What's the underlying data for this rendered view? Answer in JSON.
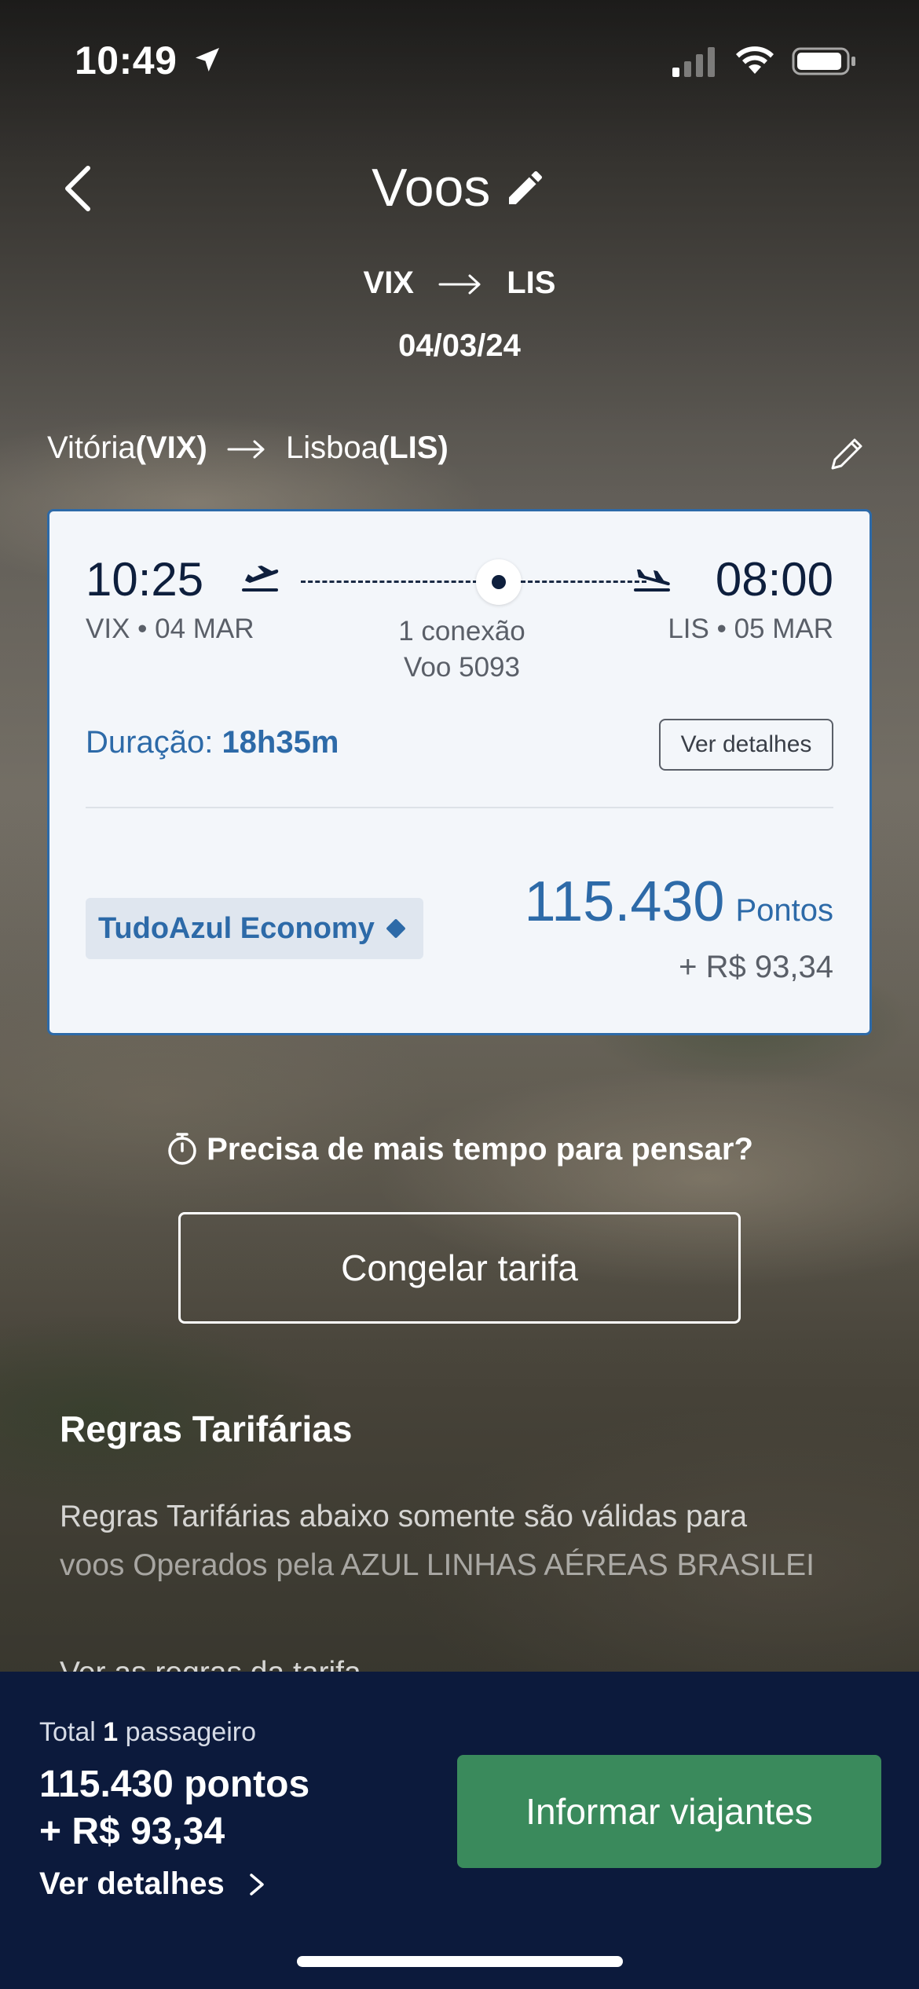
{
  "status_bar": {
    "time": "10:49"
  },
  "header": {
    "title": "Voos",
    "origin_code": "VIX",
    "destination_code": "LIS",
    "date": "04/03/24"
  },
  "leg": {
    "origin_city": "Vitória",
    "origin_code": "(VIX)",
    "destination_city": "Lisboa",
    "destination_code": "(LIS)"
  },
  "flight_card": {
    "departure_time": "10:25",
    "departure_info": "VIX • 04 MAR",
    "arrival_time": "08:00",
    "arrival_info": "LIS • 05 MAR",
    "connections": "1 conexão",
    "flight_number": "Voo 5093",
    "duration_label": "Duração:",
    "duration_value": "18h35m",
    "details_button": "Ver detalhes",
    "fare_name": "TudoAzul Economy",
    "points": "115.430",
    "points_unit": "Pontos",
    "money": "+ R$ 93,34",
    "accent_color": "#2d6aa8"
  },
  "freeze": {
    "question": "Precisa de mais tempo para pensar?",
    "button": "Congelar tarifa"
  },
  "rules": {
    "title": "Regras Tarifárias",
    "line1": "Regras Tarifárias abaixo somente são válidas para",
    "line2": "voos Operados pela AZUL LINHAS AÉREAS BRASILEI",
    "link": "Ver as regras da tarifa"
  },
  "bottom_bar": {
    "total_prefix": "Total",
    "passenger_count": "1",
    "passenger_label": "passageiro",
    "points_total": "115.430 pontos",
    "money_total": "+ R$ 93,34",
    "details_link": "Ver detalhes",
    "cta": "Informar viajantes",
    "cta_color": "#3a8a5c"
  }
}
